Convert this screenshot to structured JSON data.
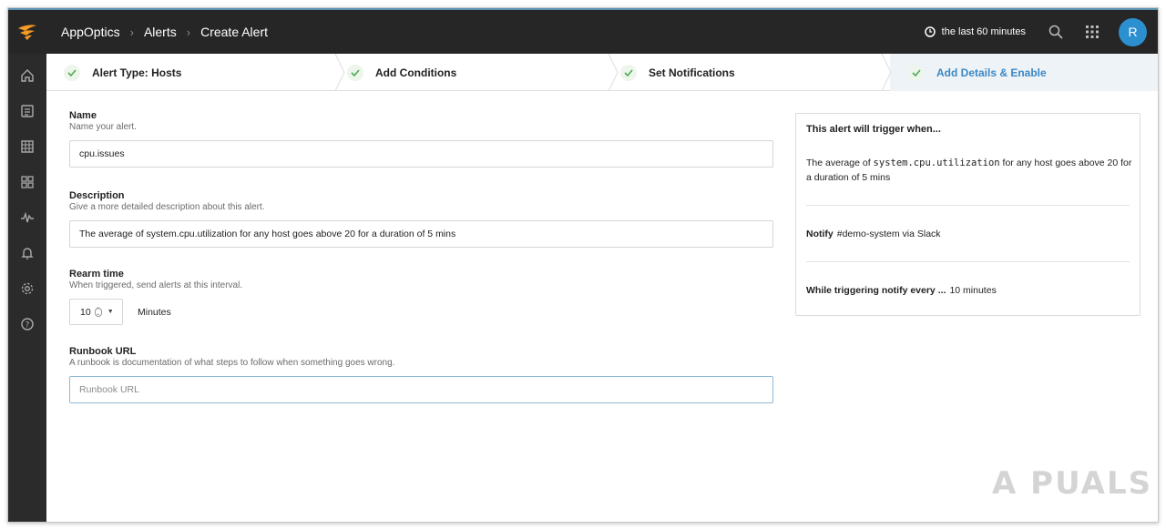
{
  "header": {
    "breadcrumbs": [
      "AppOptics",
      "Alerts",
      "Create Alert"
    ],
    "time_range": "the last 60 minutes",
    "avatar_letter": "R",
    "accent_color": "#2b8fd0"
  },
  "sidebar": {
    "items": [
      {
        "icon": "home-icon"
      },
      {
        "icon": "dashboards-icon"
      },
      {
        "icon": "metrics-grid-icon"
      },
      {
        "icon": "services-icon"
      },
      {
        "icon": "activity-icon"
      },
      {
        "icon": "bell-icon"
      },
      {
        "icon": "gear-icon"
      },
      {
        "icon": "help-icon"
      }
    ]
  },
  "steps": [
    {
      "label": "Alert Type: Hosts",
      "done": true
    },
    {
      "label": "Add Conditions",
      "done": true
    },
    {
      "label": "Set Notifications",
      "done": true
    },
    {
      "label": "Add Details & Enable",
      "done": true,
      "active": true
    }
  ],
  "form": {
    "name": {
      "label": "Name",
      "help": "Name your alert.",
      "value": "cpu.issues"
    },
    "description": {
      "label": "Description",
      "help": "Give a more detailed description about this alert.",
      "value": "The average of system.cpu.utilization for any host goes above 20 for a duration of 5 mins"
    },
    "rearm": {
      "label": "Rearm time",
      "help": "When triggered, send alerts at this interval.",
      "value": "10",
      "unit": "Minutes"
    },
    "runbook": {
      "label": "Runbook URL",
      "help": "A runbook is documentation of what steps to follow when something goes wrong.",
      "placeholder": "Runbook URL"
    }
  },
  "summary": {
    "title": "This alert will trigger when...",
    "text_pre": "The average of ",
    "metric": "system.cpu.utilization",
    "text_post": " for any host goes above 20 for a duration of 5 mins",
    "notify_label": "Notify",
    "notify_value": "#demo-system via Slack",
    "repeat_label": "While triggering notify every ...",
    "repeat_value": "10 minutes"
  },
  "watermark": "A  PUALS"
}
